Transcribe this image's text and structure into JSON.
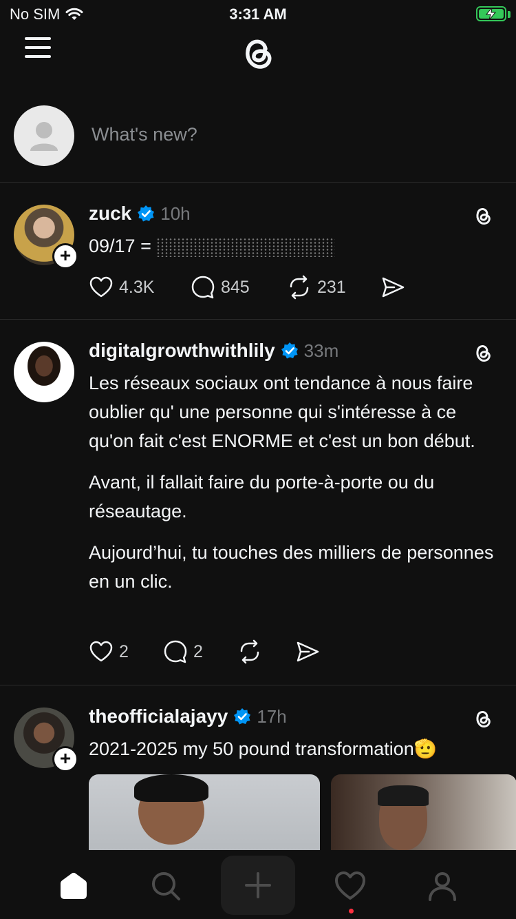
{
  "status_bar": {
    "carrier": "No SIM",
    "time": "3:31 AM",
    "battery_charging": true
  },
  "composer": {
    "placeholder": "What's new?"
  },
  "posts": [
    {
      "username": "zuck",
      "verified": true,
      "time": "10h",
      "text_prefix": "09/17 =",
      "likes": "4.3K",
      "comments": "845",
      "reposts": "231",
      "can_follow": true
    },
    {
      "username": "digitalgrowthwithlily",
      "verified": true,
      "time": "33m",
      "paragraphs": [
        "Les réseaux sociaux ont tendance à nous faire oublier qu' une personne qui s'intéresse à ce qu'on fait c'est ENORME et c'est un bon début.",
        "Avant, il fallait faire du porte-à-porte ou du réseautage.",
        "Aujourd’hui, tu touches des milliers de personnes en un clic."
      ],
      "likes": "2",
      "comments": "2",
      "reposts": "",
      "can_follow": false
    },
    {
      "username": "theofficialajayy",
      "verified": true,
      "time": "17h",
      "text": "2021-2025 my 50 pound transformation🫡",
      "can_follow": true
    }
  ],
  "tab_bar": {
    "items": [
      "home",
      "search",
      "create",
      "activity",
      "profile"
    ],
    "active": "home",
    "activity_has_notification": true
  },
  "colors": {
    "background": "#101010",
    "verified": "#0095f6",
    "notification_dot": "#ff3040",
    "battery": "#34c759"
  }
}
